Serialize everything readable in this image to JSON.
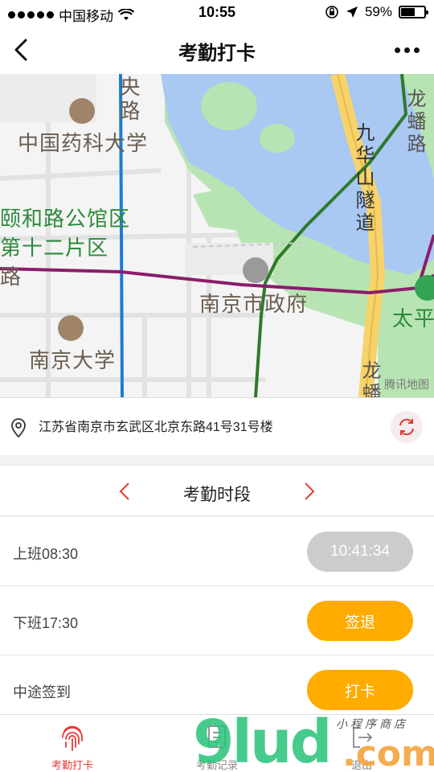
{
  "status_bar": {
    "carrier": "中国移动",
    "time": "10:55",
    "battery_percent": "59%",
    "battery_level": 0.59
  },
  "nav": {
    "title": "考勤打卡"
  },
  "map": {
    "labels": {
      "road_yang": "央路",
      "pharma_univ": "中国药科大学",
      "yihe_road": "颐和路公馆区",
      "twelfth_area": "第十二片区",
      "road_lu": "路",
      "city_gov": "南京市政府",
      "nanjing_univ": "南京大学",
      "jiuhua_tunnel": "九华山隧道",
      "longpan_road": "龙蟠路",
      "taiping": "太平",
      "long_bottom": "龙蟠"
    },
    "provider": "腾讯地图",
    "colors": {
      "water": "#a9c8f2",
      "green": "#b8e4b4",
      "metro_purple": "#8b1d6b",
      "metro_green": "#2f7a2a",
      "metro_blue": "#1e7bd0",
      "expressway": "#f6d36b"
    }
  },
  "address": {
    "text": "江苏省南京市玄武区北京东路41号31号楼"
  },
  "period": {
    "label": "考勤时段"
  },
  "rows": [
    {
      "label": "上班08:30",
      "button": "10:41:34",
      "state": "done"
    },
    {
      "label": "下班17:30",
      "button": "签退",
      "state": "active"
    },
    {
      "label": "中途签到",
      "button": "打卡",
      "state": "active"
    }
  ],
  "tabs": [
    {
      "label": "考勤打卡",
      "active": true,
      "icon": "fingerprint-icon"
    },
    {
      "label": "考勤记录",
      "active": false,
      "icon": "record-icon"
    },
    {
      "label": "退出",
      "active": false,
      "icon": "exit-icon"
    }
  ],
  "watermark": {
    "digits": "9lud",
    "suffix": ".com",
    "script": "小程序商店"
  },
  "colors": {
    "accent_red": "#e53935",
    "button_orange": "#ffab00",
    "button_gray": "#cccccc"
  }
}
